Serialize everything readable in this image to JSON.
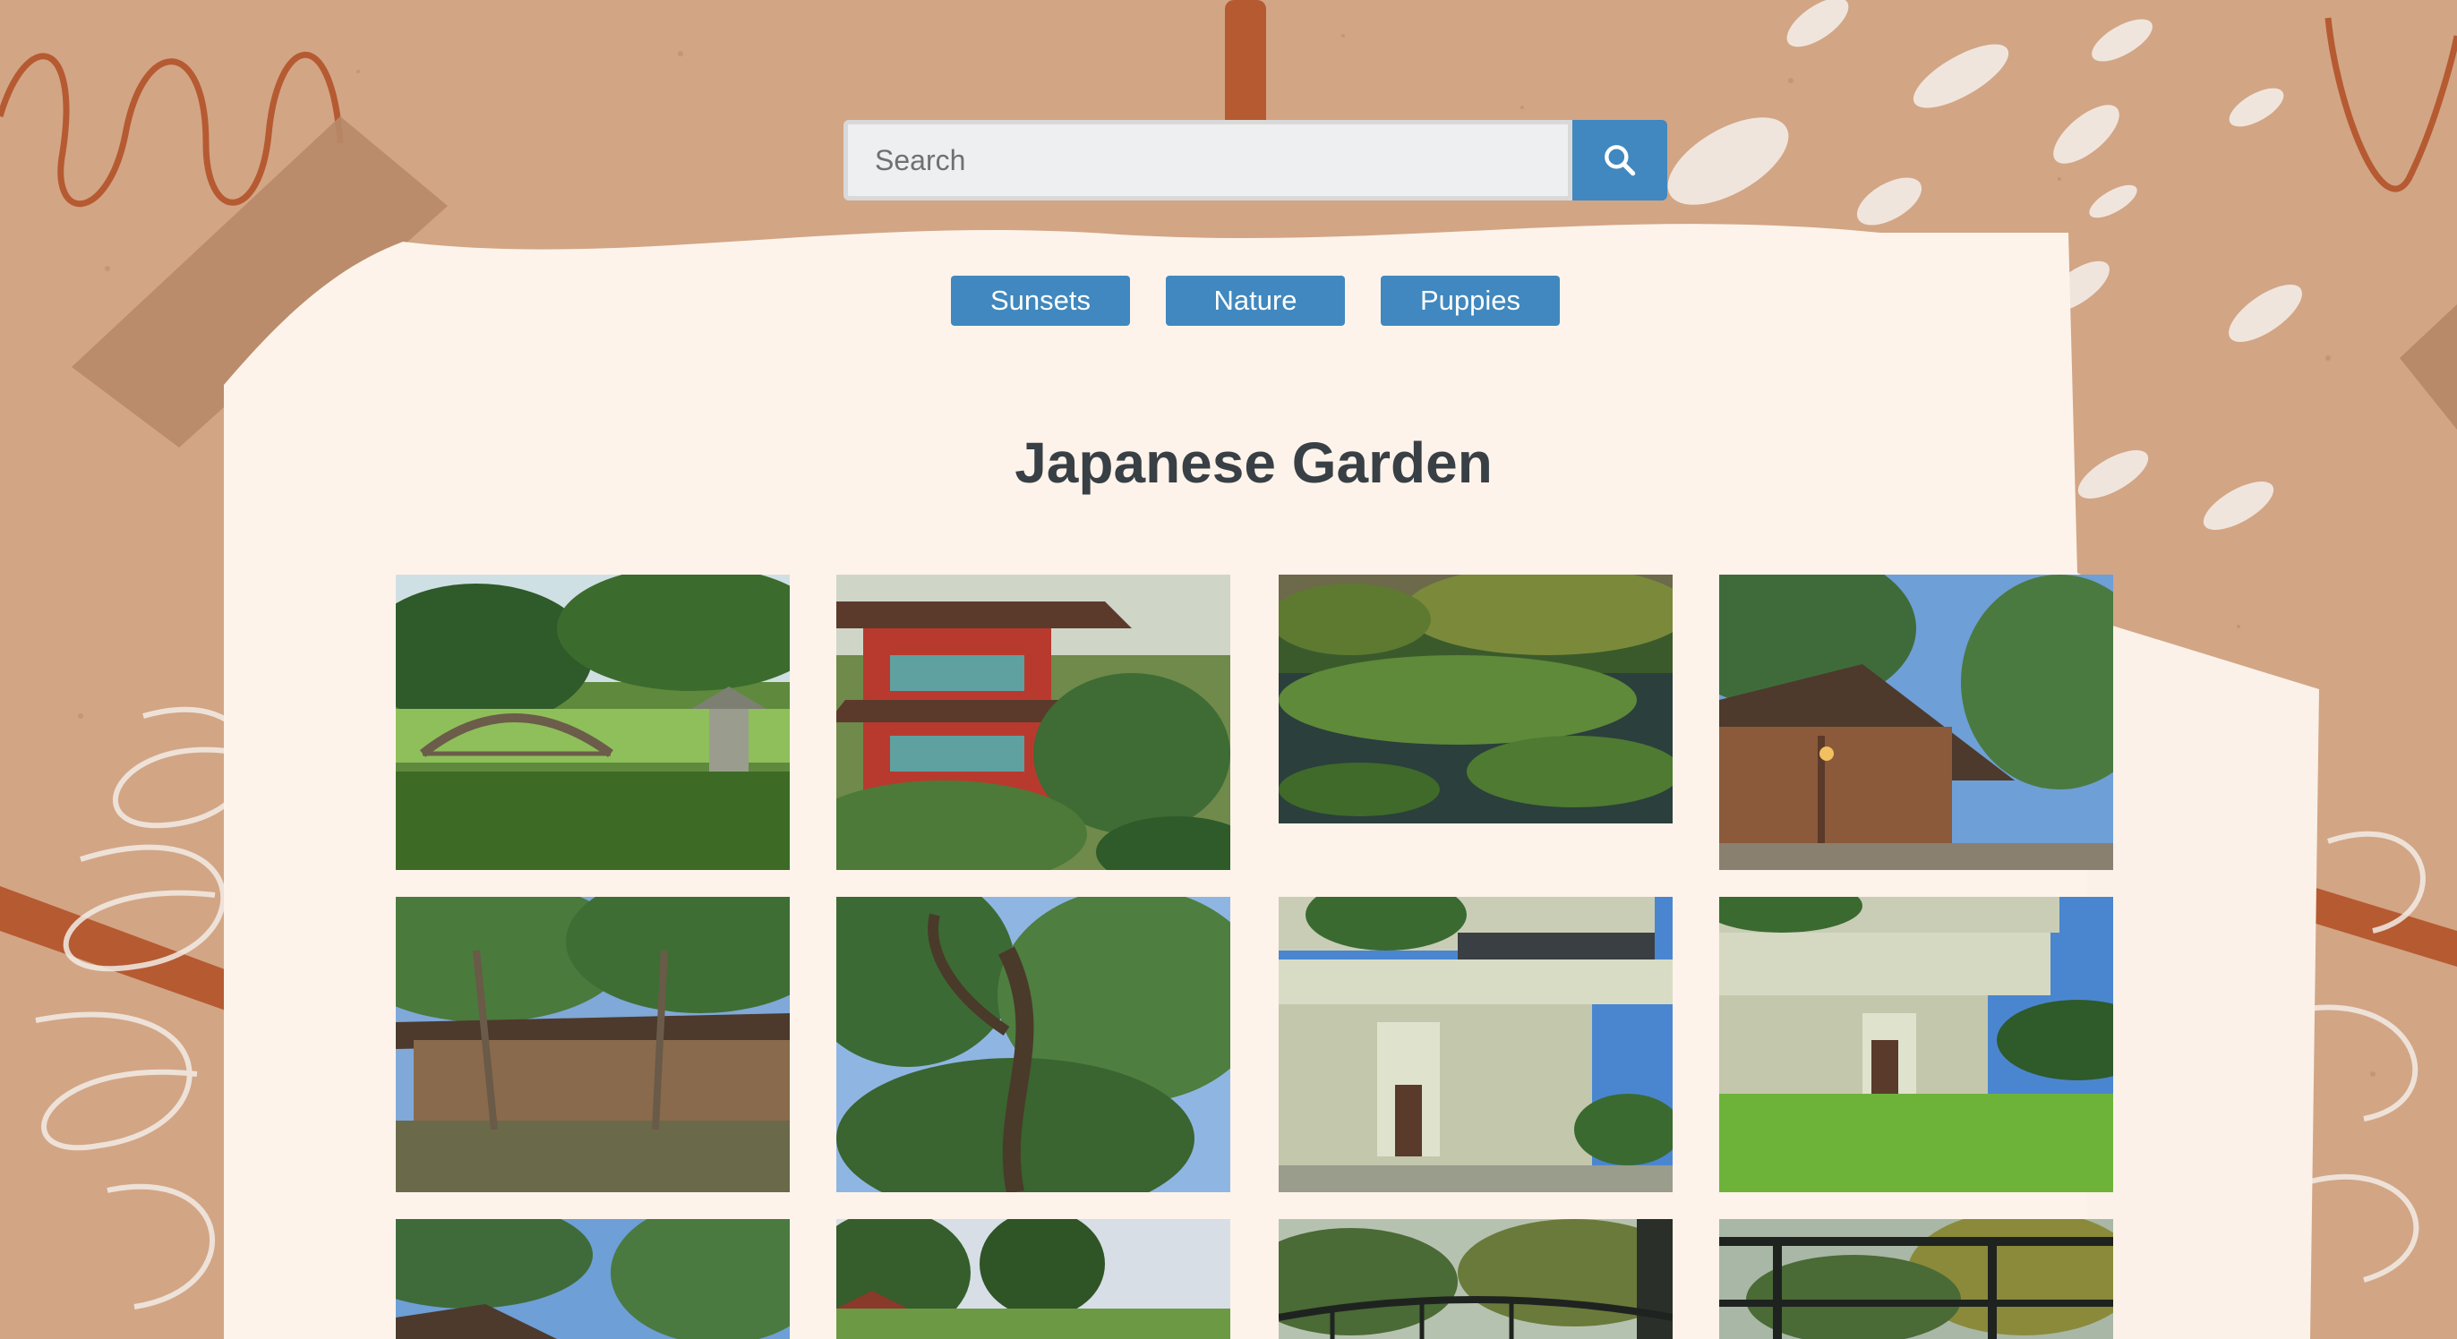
{
  "search": {
    "placeholder": "Search",
    "icon": "search-icon"
  },
  "tags": [
    "Sunsets",
    "Nature",
    "Puppies"
  ],
  "gallery": {
    "title": "Japanese Garden",
    "photos": [
      {
        "subject": "arched wooden bridge with stone lantern"
      },
      {
        "subject": "red pagoda gate among trees"
      },
      {
        "subject": "lily pond with dense foliage"
      },
      {
        "subject": "wooden pavilion under blue sky"
      },
      {
        "subject": "low building beneath trees"
      },
      {
        "subject": "tree canopy looking up"
      },
      {
        "subject": "modern concrete building corner"
      },
      {
        "subject": "concrete building over green lawn"
      },
      {
        "subject": "tree canopy with building"
      },
      {
        "subject": "park lawn with trees"
      },
      {
        "subject": "bridge railing by trees"
      },
      {
        "subject": "dark railing with autumn trees"
      }
    ]
  },
  "colors": {
    "background": "#d2a585",
    "paper": "#fdf3ea",
    "accent": "#4088bf",
    "title": "#383f45"
  }
}
